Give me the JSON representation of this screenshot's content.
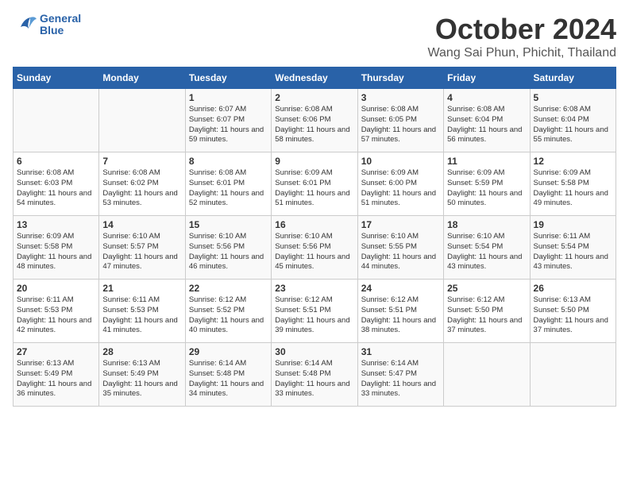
{
  "logo": {
    "line1": "General",
    "line2": "Blue"
  },
  "title": "October 2024",
  "location": "Wang Sai Phun, Phichit, Thailand",
  "headers": [
    "Sunday",
    "Monday",
    "Tuesday",
    "Wednesday",
    "Thursday",
    "Friday",
    "Saturday"
  ],
  "weeks": [
    [
      {
        "day": "",
        "sunrise": "",
        "sunset": "",
        "daylight": ""
      },
      {
        "day": "",
        "sunrise": "",
        "sunset": "",
        "daylight": ""
      },
      {
        "day": "1",
        "sunrise": "Sunrise: 6:07 AM",
        "sunset": "Sunset: 6:07 PM",
        "daylight": "Daylight: 11 hours and 59 minutes."
      },
      {
        "day": "2",
        "sunrise": "Sunrise: 6:08 AM",
        "sunset": "Sunset: 6:06 PM",
        "daylight": "Daylight: 11 hours and 58 minutes."
      },
      {
        "day": "3",
        "sunrise": "Sunrise: 6:08 AM",
        "sunset": "Sunset: 6:05 PM",
        "daylight": "Daylight: 11 hours and 57 minutes."
      },
      {
        "day": "4",
        "sunrise": "Sunrise: 6:08 AM",
        "sunset": "Sunset: 6:04 PM",
        "daylight": "Daylight: 11 hours and 56 minutes."
      },
      {
        "day": "5",
        "sunrise": "Sunrise: 6:08 AM",
        "sunset": "Sunset: 6:04 PM",
        "daylight": "Daylight: 11 hours and 55 minutes."
      }
    ],
    [
      {
        "day": "6",
        "sunrise": "Sunrise: 6:08 AM",
        "sunset": "Sunset: 6:03 PM",
        "daylight": "Daylight: 11 hours and 54 minutes."
      },
      {
        "day": "7",
        "sunrise": "Sunrise: 6:08 AM",
        "sunset": "Sunset: 6:02 PM",
        "daylight": "Daylight: 11 hours and 53 minutes."
      },
      {
        "day": "8",
        "sunrise": "Sunrise: 6:08 AM",
        "sunset": "Sunset: 6:01 PM",
        "daylight": "Daylight: 11 hours and 52 minutes."
      },
      {
        "day": "9",
        "sunrise": "Sunrise: 6:09 AM",
        "sunset": "Sunset: 6:01 PM",
        "daylight": "Daylight: 11 hours and 51 minutes."
      },
      {
        "day": "10",
        "sunrise": "Sunrise: 6:09 AM",
        "sunset": "Sunset: 6:00 PM",
        "daylight": "Daylight: 11 hours and 51 minutes."
      },
      {
        "day": "11",
        "sunrise": "Sunrise: 6:09 AM",
        "sunset": "Sunset: 5:59 PM",
        "daylight": "Daylight: 11 hours and 50 minutes."
      },
      {
        "day": "12",
        "sunrise": "Sunrise: 6:09 AM",
        "sunset": "Sunset: 5:58 PM",
        "daylight": "Daylight: 11 hours and 49 minutes."
      }
    ],
    [
      {
        "day": "13",
        "sunrise": "Sunrise: 6:09 AM",
        "sunset": "Sunset: 5:58 PM",
        "daylight": "Daylight: 11 hours and 48 minutes."
      },
      {
        "day": "14",
        "sunrise": "Sunrise: 6:10 AM",
        "sunset": "Sunset: 5:57 PM",
        "daylight": "Daylight: 11 hours and 47 minutes."
      },
      {
        "day": "15",
        "sunrise": "Sunrise: 6:10 AM",
        "sunset": "Sunset: 5:56 PM",
        "daylight": "Daylight: 11 hours and 46 minutes."
      },
      {
        "day": "16",
        "sunrise": "Sunrise: 6:10 AM",
        "sunset": "Sunset: 5:56 PM",
        "daylight": "Daylight: 11 hours and 45 minutes."
      },
      {
        "day": "17",
        "sunrise": "Sunrise: 6:10 AM",
        "sunset": "Sunset: 5:55 PM",
        "daylight": "Daylight: 11 hours and 44 minutes."
      },
      {
        "day": "18",
        "sunrise": "Sunrise: 6:10 AM",
        "sunset": "Sunset: 5:54 PM",
        "daylight": "Daylight: 11 hours and 43 minutes."
      },
      {
        "day": "19",
        "sunrise": "Sunrise: 6:11 AM",
        "sunset": "Sunset: 5:54 PM",
        "daylight": "Daylight: 11 hours and 43 minutes."
      }
    ],
    [
      {
        "day": "20",
        "sunrise": "Sunrise: 6:11 AM",
        "sunset": "Sunset: 5:53 PM",
        "daylight": "Daylight: 11 hours and 42 minutes."
      },
      {
        "day": "21",
        "sunrise": "Sunrise: 6:11 AM",
        "sunset": "Sunset: 5:53 PM",
        "daylight": "Daylight: 11 hours and 41 minutes."
      },
      {
        "day": "22",
        "sunrise": "Sunrise: 6:12 AM",
        "sunset": "Sunset: 5:52 PM",
        "daylight": "Daylight: 11 hours and 40 minutes."
      },
      {
        "day": "23",
        "sunrise": "Sunrise: 6:12 AM",
        "sunset": "Sunset: 5:51 PM",
        "daylight": "Daylight: 11 hours and 39 minutes."
      },
      {
        "day": "24",
        "sunrise": "Sunrise: 6:12 AM",
        "sunset": "Sunset: 5:51 PM",
        "daylight": "Daylight: 11 hours and 38 minutes."
      },
      {
        "day": "25",
        "sunrise": "Sunrise: 6:12 AM",
        "sunset": "Sunset: 5:50 PM",
        "daylight": "Daylight: 11 hours and 37 minutes."
      },
      {
        "day": "26",
        "sunrise": "Sunrise: 6:13 AM",
        "sunset": "Sunset: 5:50 PM",
        "daylight": "Daylight: 11 hours and 37 minutes."
      }
    ],
    [
      {
        "day": "27",
        "sunrise": "Sunrise: 6:13 AM",
        "sunset": "Sunset: 5:49 PM",
        "daylight": "Daylight: 11 hours and 36 minutes."
      },
      {
        "day": "28",
        "sunrise": "Sunrise: 6:13 AM",
        "sunset": "Sunset: 5:49 PM",
        "daylight": "Daylight: 11 hours and 35 minutes."
      },
      {
        "day": "29",
        "sunrise": "Sunrise: 6:14 AM",
        "sunset": "Sunset: 5:48 PM",
        "daylight": "Daylight: 11 hours and 34 minutes."
      },
      {
        "day": "30",
        "sunrise": "Sunrise: 6:14 AM",
        "sunset": "Sunset: 5:48 PM",
        "daylight": "Daylight: 11 hours and 33 minutes."
      },
      {
        "day": "31",
        "sunrise": "Sunrise: 6:14 AM",
        "sunset": "Sunset: 5:47 PM",
        "daylight": "Daylight: 11 hours and 33 minutes."
      },
      {
        "day": "",
        "sunrise": "",
        "sunset": "",
        "daylight": ""
      },
      {
        "day": "",
        "sunrise": "",
        "sunset": "",
        "daylight": ""
      }
    ]
  ]
}
